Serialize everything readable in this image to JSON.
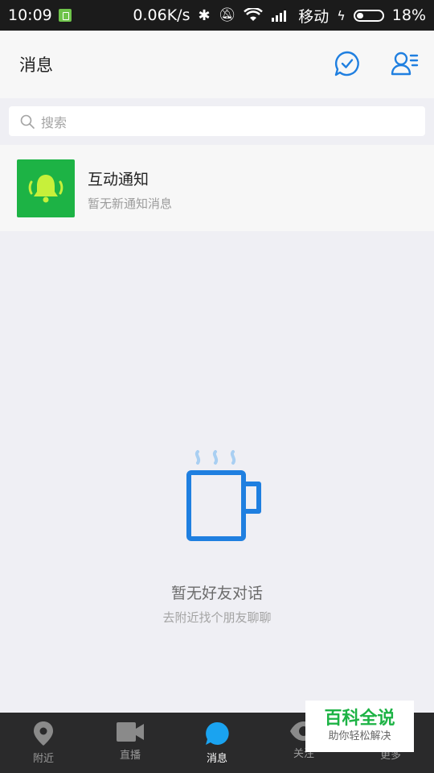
{
  "status_bar": {
    "time": "10:09",
    "speed": "0.06K/s",
    "carrier": "移动",
    "battery": "18%"
  },
  "header": {
    "title": "消息"
  },
  "search": {
    "placeholder": "搜索"
  },
  "notification": {
    "title": "互动通知",
    "subtitle": "暂无新通知消息"
  },
  "empty_state": {
    "title": "暂无好友对话",
    "subtitle": "去附近找个朋友聊聊"
  },
  "bottom_nav": {
    "items": [
      {
        "label": "附近",
        "icon": "location-pin-icon"
      },
      {
        "label": "直播",
        "icon": "video-camera-icon"
      },
      {
        "label": "消息",
        "icon": "chat-bubble-icon"
      },
      {
        "label": "关注",
        "icon": "eye-icon"
      },
      {
        "label": "更多",
        "icon": "more-icon"
      }
    ],
    "active_index": 2
  },
  "watermark": {
    "title": "百科全说",
    "subtitle": "助你轻松解决"
  },
  "colors": {
    "accent_blue": "#1f7fe0",
    "brand_green": "#1db345",
    "nav_bg": "#2a2a2b"
  }
}
